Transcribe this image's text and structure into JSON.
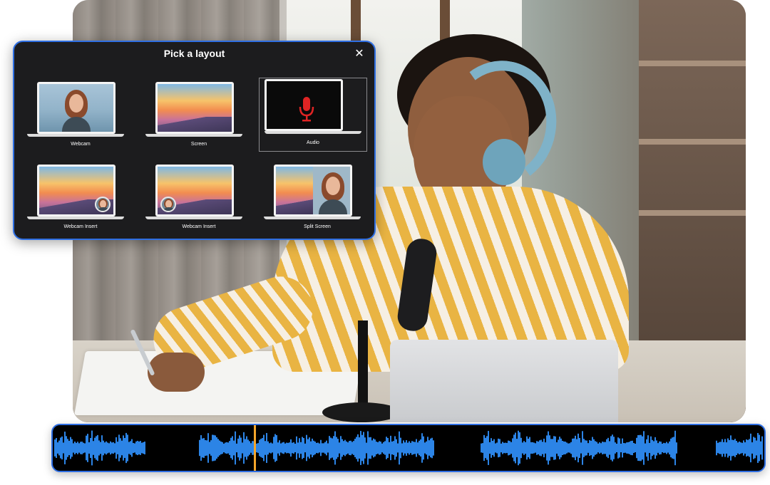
{
  "dialog": {
    "title": "Pick a layout",
    "close_label": "✕",
    "layouts": [
      {
        "label": "Webcam",
        "selected": false
      },
      {
        "label": "Screen",
        "selected": false
      },
      {
        "label": "Audio",
        "selected": true
      },
      {
        "label": "Webcam Insert",
        "selected": false
      },
      {
        "label": "Webcam Insert",
        "selected": false
      },
      {
        "label": "Split Screen",
        "selected": false
      }
    ]
  },
  "colors": {
    "accent": "#2f6fe3",
    "waveform": "#2c84e6",
    "playhead": "#f5a52a",
    "mic": "#e02424"
  },
  "icons": {
    "close": "close-icon",
    "audio": "microphone-icon"
  }
}
